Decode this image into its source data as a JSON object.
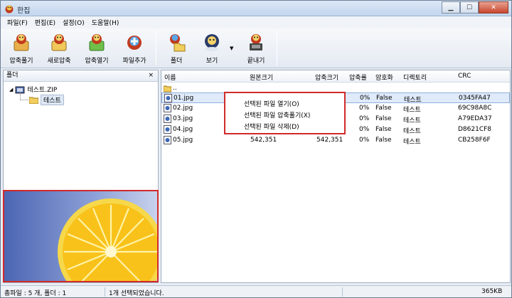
{
  "window": {
    "title": "한집"
  },
  "menubar": {
    "items": [
      "파일(F)",
      "편집(E)",
      "설정(O)",
      "도움말(H)"
    ]
  },
  "toolbar": {
    "buttons": [
      "압축풀기",
      "새로압축",
      "압축열기",
      "파일추가",
      "폴더",
      "보기",
      "끝내기"
    ]
  },
  "left_panel": {
    "title": "폴더",
    "close": "×",
    "tree_root": "테스트.ZIP",
    "tree_child": "테스트"
  },
  "columns": [
    "이름",
    "원본크기",
    "압축크기",
    "압축률",
    "암호화",
    "디렉토리",
    "CRC"
  ],
  "files": [
    {
      "name": "..",
      "orig": "",
      "comp": "",
      "ratio": "",
      "enc": "",
      "dir": "",
      "crc": ""
    },
    {
      "name": "01.jpg",
      "orig": "",
      "comp": "",
      "ratio": "0%",
      "enc": "False",
      "dir": "테스트",
      "crc": "0345FA47"
    },
    {
      "name": "02.jpg",
      "orig": "",
      "comp": "",
      "ratio": "0%",
      "enc": "False",
      "dir": "테스트",
      "crc": "69C98A8C"
    },
    {
      "name": "03.jpg",
      "orig": "",
      "comp": "",
      "ratio": "0%",
      "enc": "False",
      "dir": "테스트",
      "crc": "A79EDA37"
    },
    {
      "name": "04.jpg",
      "orig": "",
      "comp": "",
      "ratio": "0%",
      "enc": "False",
      "dir": "테스트",
      "crc": "D8621CF8"
    },
    {
      "name": "05.jpg",
      "orig": "542,351",
      "comp": "542,351",
      "ratio": "0%",
      "enc": "False",
      "dir": "테스트",
      "crc": "CB258F6F"
    }
  ],
  "context_menu": {
    "items": [
      "선택된 파일 열기(O)",
      "선택된 파일 압축풀기(X)",
      "선택된 파일 삭제(D)"
    ]
  },
  "status": {
    "left": "총파일 : 5 개, 폴더 : 1",
    "middle": "1개 선택되었습니다.",
    "right": "365KB"
  },
  "colors": {
    "accent": "#d02a2a",
    "selection": "#dfeafa"
  }
}
